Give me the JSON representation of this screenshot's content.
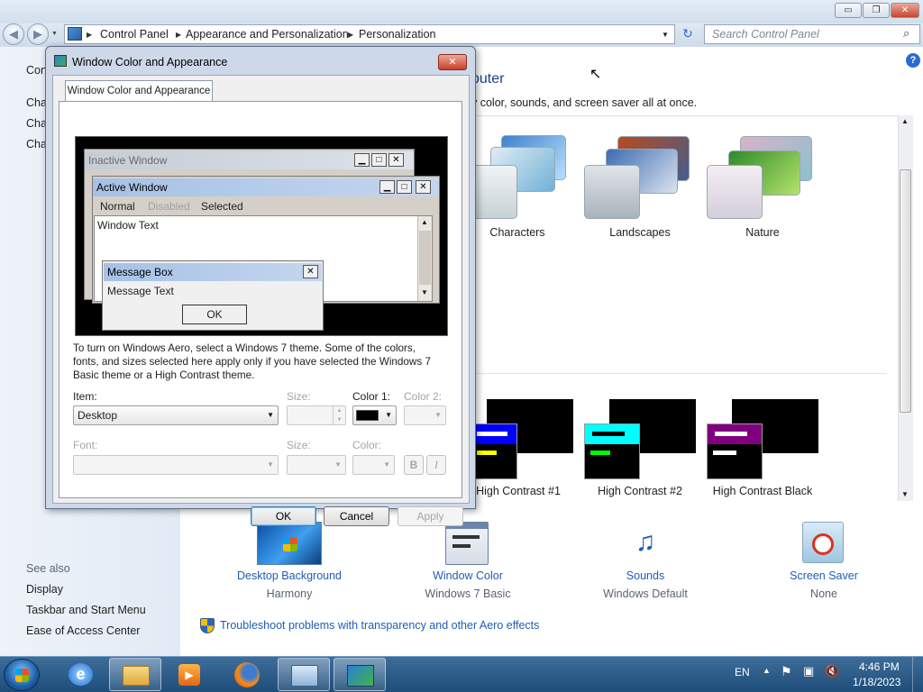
{
  "window": {
    "minimize": "▭",
    "restore": "❐",
    "close": "✕"
  },
  "address": {
    "crumbs": [
      "Control Panel",
      "Appearance and Personalization",
      "Personalization"
    ],
    "search_placeholder": "Search Control Panel"
  },
  "sidebar": {
    "top_link": "Con",
    "links": [
      "Cha",
      "Cha",
      "Cha"
    ],
    "see_also": "See also",
    "see_also_links": [
      "Display",
      "Taskbar and Start Menu",
      "Ease of Access Center"
    ]
  },
  "content": {
    "heading_fragment": "puter",
    "subtext_fragment": "v color, sounds, and screen saver all at once.",
    "themes": [
      "Characters",
      "Landscapes",
      "Nature"
    ],
    "hc_themes": [
      "High Contrast #1",
      "High Contrast #2",
      "High Contrast Black"
    ]
  },
  "tiles": [
    {
      "label": "Desktop Background",
      "value": "Harmony",
      "icon": "desktop-background-icon"
    },
    {
      "label": "Window Color",
      "value": "Windows 7 Basic",
      "icon": "window-color-icon"
    },
    {
      "label": "Sounds",
      "value": "Windows Default",
      "icon": "sounds-icon"
    },
    {
      "label": "Screen Saver",
      "value": "None",
      "icon": "screen-saver-icon"
    }
  ],
  "troubleshoot": "Troubleshoot problems with transparency and other Aero effects",
  "dialog": {
    "title": "Window Color and Appearance",
    "tab": "Window Color and Appearance",
    "preview": {
      "inactive_title": "Inactive Window",
      "active_title": "Active Window",
      "menu": [
        "Normal",
        "Disabled",
        "Selected"
      ],
      "window_text": "Window Text",
      "msgbox_title": "Message Box",
      "msgbox_text": "Message Text",
      "msgbox_ok": "OK"
    },
    "description": "To turn on Windows Aero, select a Windows 7 theme.  Some of the colors, fonts, and sizes selected here apply only if you have selected the Windows 7 Basic theme or a High Contrast theme.",
    "item_label": "Item:",
    "item_value": "Desktop",
    "size_label": "Size:",
    "color1_label": "Color 1:",
    "color2_label": "Color 2:",
    "font_label": "Font:",
    "size2_label": "Size:",
    "color_label": "Color:",
    "bold": "B",
    "italic": "I",
    "ok": "OK",
    "cancel": "Cancel",
    "apply": "Apply"
  },
  "tray": {
    "lang": "EN",
    "time": "4:46 PM",
    "date": "1/18/2023"
  },
  "colors": {
    "link": "#1f5cb6",
    "active_caption": "#a6c1e6",
    "hc1_bar": "#0000ff",
    "hc2_bar": "#00ffff",
    "hcb_bar": "#800080"
  }
}
